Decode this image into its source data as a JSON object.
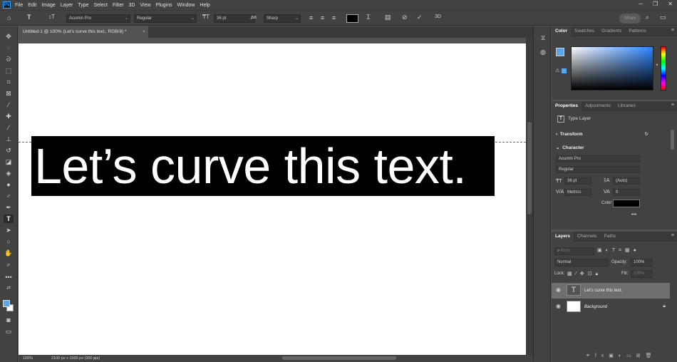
{
  "app": {
    "logo": "Ps"
  },
  "menu": [
    "File",
    "Edit",
    "Image",
    "Layer",
    "Type",
    "Select",
    "Filter",
    "3D",
    "View",
    "Plugins",
    "Window",
    "Help"
  ],
  "window_controls": {
    "minimize": "─",
    "restore": "❐",
    "close": "✕"
  },
  "options": {
    "font_family": "Acumin Pro",
    "font_style": "Regular",
    "font_size": "36 pt",
    "aa_label": "aa",
    "antialias": "Sharp",
    "text_color": "#000000",
    "share_label": "Share"
  },
  "document": {
    "tab_title": "Untitled-1 @ 100% (Let’s curve this text., RGB/8) *",
    "text": "Let’s curve this text.",
    "zoom": "100%",
    "doc_info": "2100 px x 1500 px (300 ppi)"
  },
  "colors": {
    "foreground": "#5aa6e8",
    "background": "#ffffff"
  },
  "color_panel": {
    "tabs": [
      "Color",
      "Swatches",
      "Gradients",
      "Patterns"
    ]
  },
  "properties_panel": {
    "tabs": [
      "Properties",
      "Adjustments",
      "Libraries"
    ],
    "layer_type": "Type Layer",
    "transform_label": "Transform",
    "character_label": "Character",
    "font_family": "Acumin Pro",
    "font_style": "Regular",
    "font_size": "36 pt",
    "leading": "(Auto)",
    "kerning": "Metrics",
    "tracking": "0",
    "color_label": "Color",
    "more": "•••"
  },
  "layers_panel": {
    "tabs": [
      "Layers",
      "Channels",
      "Paths"
    ],
    "search_placeholder": "Kind",
    "blend_mode": "Normal",
    "opacity_label": "Opacity:",
    "opacity": "100%",
    "lock_label": "Lock:",
    "fill_label": "Fill:",
    "fill": "100%",
    "layers": [
      {
        "name": "Let’s curve this text.",
        "kind": "text",
        "selected": true
      },
      {
        "name": "Background",
        "kind": "background",
        "selected": false
      }
    ]
  }
}
